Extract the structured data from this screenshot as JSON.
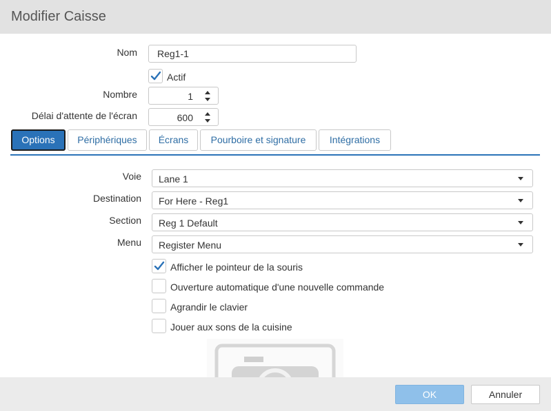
{
  "dialog": {
    "title": "Modifier Caisse"
  },
  "form": {
    "nom_label": "Nom",
    "nom_value": "Reg1-1",
    "actif_label": "Actif",
    "actif_checked": true,
    "nombre_label": "Nombre",
    "nombre_value": "1",
    "delai_label": "Délai d'attente de l'écran",
    "delai_value": "600"
  },
  "tabs": [
    {
      "label": "Options",
      "active": true
    },
    {
      "label": "Périphériques",
      "active": false
    },
    {
      "label": "Écrans",
      "active": false
    },
    {
      "label": "Pourboire et signature",
      "active": false
    },
    {
      "label": "Intégrations",
      "active": false
    }
  ],
  "options": {
    "voie_label": "Voie",
    "voie_value": "Lane 1",
    "destination_label": "Destination",
    "destination_value": "For Here - Reg1",
    "section_label": "Section",
    "section_value": "Reg 1 Default",
    "menu_label": "Menu",
    "menu_value": "Register Menu",
    "checkboxes": [
      {
        "label": "Afficher le pointeur de la souris",
        "checked": true
      },
      {
        "label": "Ouverture automatique d'une nouvelle commande",
        "checked": false
      },
      {
        "label": "Agrandir le clavier",
        "checked": false
      },
      {
        "label": "Jouer aux sons de la cuisine",
        "checked": false
      }
    ]
  },
  "footer": {
    "ok_label": "OK",
    "cancel_label": "Annuler"
  },
  "colors": {
    "accent": "#2a72b8",
    "ok_button": "#8fc0ea",
    "check": "#2a72b8"
  },
  "icons": {
    "image_placeholder": "camera-icon"
  }
}
